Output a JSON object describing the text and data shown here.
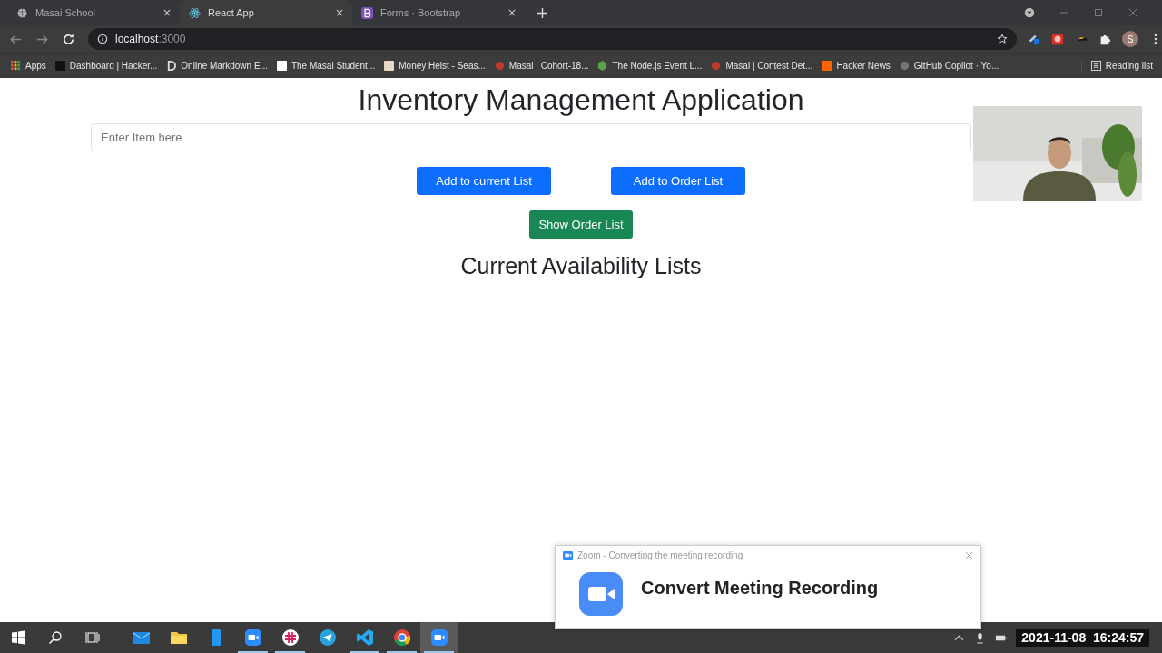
{
  "browser": {
    "tabs": [
      {
        "title": "Masai School",
        "selected": false
      },
      {
        "title": "React App",
        "selected": true
      },
      {
        "title": "Forms · Bootstrap",
        "selected": false
      }
    ],
    "address": {
      "host": "localhost",
      "port": ":3000"
    },
    "bookmarks": [
      {
        "label": "Apps"
      },
      {
        "label": "Dashboard | Hacker..."
      },
      {
        "label": "Online Markdown E..."
      },
      {
        "label": "The Masai Student..."
      },
      {
        "label": "Money Heist - Seas..."
      },
      {
        "label": "Masai | Cohort-18..."
      },
      {
        "label": "The Node.js Event L..."
      },
      {
        "label": "Masai | Contest Det..."
      },
      {
        "label": "Hacker News"
      },
      {
        "label": "GitHub Copilot · Yo..."
      }
    ],
    "reading_list": "Reading list",
    "profile": "S"
  },
  "page": {
    "title": "Inventory Management Application",
    "input": {
      "placeholder": "Enter Item here"
    },
    "buttons": [
      {
        "label": "Add to current List",
        "kind": "primary"
      },
      {
        "label": "Add to Order List",
        "kind": "primary"
      }
    ],
    "show_button": {
      "label": "Show Order List",
      "kind": "success"
    },
    "heading": "Current Availability Lists"
  },
  "zoom_dialog": {
    "window_title": "Zoom - Converting the meeting recording",
    "heading": "Convert Meeting Recording"
  },
  "taskbar": {
    "apps": [
      {
        "kind": "mail",
        "running": false,
        "active": false
      },
      {
        "kind": "folder",
        "running": false,
        "active": false
      },
      {
        "kind": "phone",
        "running": false,
        "active": false
      },
      {
        "kind": "zoom",
        "running": true,
        "active": false
      },
      {
        "kind": "slack",
        "running": true,
        "active": false
      },
      {
        "kind": "telegram",
        "running": false,
        "active": false
      },
      {
        "kind": "vscode",
        "running": true,
        "active": false
      },
      {
        "kind": "chrome",
        "running": true,
        "active": false
      },
      {
        "kind": "zoom",
        "running": true,
        "active": true
      }
    ],
    "clock": "2021-11-08  16:24:57"
  }
}
